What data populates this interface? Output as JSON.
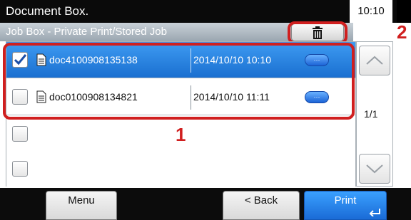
{
  "header": {
    "title": "Document Box.",
    "time": "10:10",
    "subtitle": "Job Box - Private Print/Stored Job"
  },
  "annotations": {
    "one": "1",
    "two": "2"
  },
  "list": {
    "rows": [
      {
        "name": "doc4100908135138",
        "date": "2014/10/10 10:10",
        "checked": true
      },
      {
        "name": "doc0100908134821",
        "date": "2014/10/10 11:11",
        "checked": false
      },
      {
        "name": "",
        "date": "",
        "checked": false
      },
      {
        "name": "",
        "date": "",
        "checked": false
      }
    ],
    "page_indicator": "1/1",
    "detail_label": "···"
  },
  "footer": {
    "menu": "Menu",
    "back": "< Back",
    "print": "Print"
  },
  "colors": {
    "accent": "#1a6fd0",
    "callout": "#d01f1f"
  },
  "icons": {
    "delete": "trash-icon",
    "file": "document-icon",
    "scroll_up": "chevron-up-icon",
    "scroll_down": "chevron-down-icon",
    "enter": "enter-arrow-icon"
  }
}
